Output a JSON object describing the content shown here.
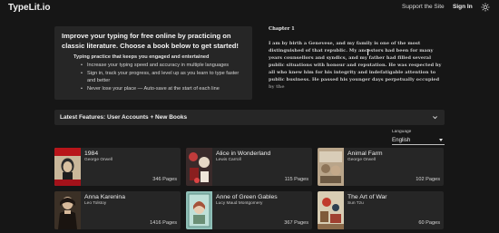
{
  "header": {
    "brand": "TypeLit.io",
    "support_label": "Support the Site",
    "signin_label": "Sign In",
    "theme_icon": "sun-icon"
  },
  "intro": {
    "headline": "Improve your typing for free online by practicing on classic literature. Choose a book below to get started!",
    "subheading": "Typing practice that keeps you engaged and entertained",
    "bullets": [
      "Increase your typing speed and accuracy in multiple languages",
      "Sign in, track your progress, and level up as you learn to type faster and better",
      "Never lose your place — Auto-save at the start of each line"
    ]
  },
  "passage": {
    "chapter": "Chapter 1",
    "text": "I am by birth a Genevese, and my family is one of the most distinguished of that republic. My ancestors had been for many years counsellors and syndics, and my father had filled several public situations with honour and reputation. He was respected by all who knew him for his integrity and indefatigable attention to public business. He passed his younger days perpetually occupied by the"
  },
  "features": {
    "title": "Latest Features: User Accounts + New Books",
    "chevron_icon": "chevron-down-icon"
  },
  "language": {
    "label": "Language",
    "value": "English"
  },
  "books": [
    {
      "title": "1984",
      "author": "George Orwell",
      "pages": "346 Pages"
    },
    {
      "title": "Alice in Wonderland",
      "author": "Lewis Carroll",
      "pages": "115 Pages"
    },
    {
      "title": "Animal Farm",
      "author": "George Orwell",
      "pages": "102 Pages"
    },
    {
      "title": "Anna Karenina",
      "author": "Leo Tolstoy",
      "pages": "1416 Pages"
    },
    {
      "title": "Anne of Green Gables",
      "author": "Lucy Maud Montgomery",
      "pages": "367 Pages"
    },
    {
      "title": "The Art of War",
      "author": "Sun Tzu",
      "pages": "60 Pages"
    }
  ],
  "colors": {
    "background": "#161616",
    "panel": "#262626",
    "text": "#e6e6e6"
  }
}
